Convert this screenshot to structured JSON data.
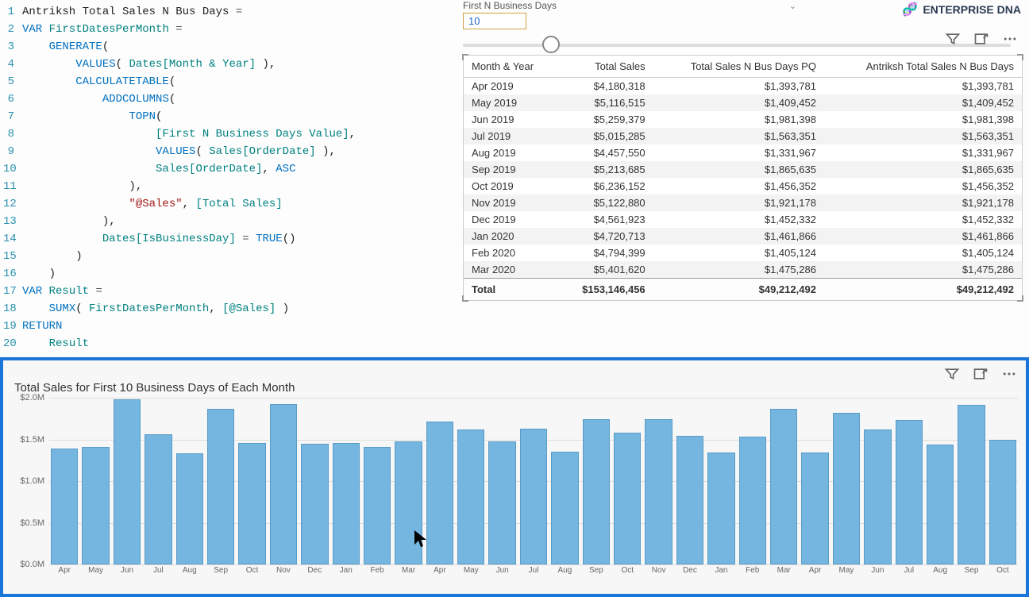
{
  "brand": {
    "text": "ENTERPRISE DNA"
  },
  "code": [
    {
      "n": "1",
      "html": "Antriksh Total Sales N Bus Days <span class='op'>=</span>"
    },
    {
      "n": "2",
      "html": "<span class='kw'>VAR</span> <span class='var'>FirstDatesPerMonth</span> <span class='op'>=</span>"
    },
    {
      "n": "3",
      "html": "    <span class='fn'>GENERATE</span>("
    },
    {
      "n": "4",
      "html": "        <span class='fn'>VALUES</span>( <span class='col'>Dates[Month &amp; Year]</span> ),"
    },
    {
      "n": "5",
      "html": "        <span class='fn'>CALCULATETABLE</span>("
    },
    {
      "n": "6",
      "html": "            <span class='fn'>ADDCOLUMNS</span>("
    },
    {
      "n": "7",
      "html": "                <span class='fn'>TOPN</span>("
    },
    {
      "n": "8",
      "html": "                    <span class='col'>[First N Business Days Value]</span>,"
    },
    {
      "n": "9",
      "html": "                    <span class='fn'>VALUES</span>( <span class='col'>Sales[OrderDate]</span> ),"
    },
    {
      "n": "10",
      "html": "                    <span class='col'>Sales[OrderDate]</span>, <span class='kw'>ASC</span>"
    },
    {
      "n": "11",
      "html": "                ),"
    },
    {
      "n": "12",
      "html": "                <span class='str'>\"@Sales\"</span>, <span class='col'>[Total Sales]</span>"
    },
    {
      "n": "13",
      "html": "            ),"
    },
    {
      "n": "14",
      "html": "            <span class='col'>Dates[IsBusinessDay]</span> <span class='op'>=</span> <span class='fn'>TRUE</span>()"
    },
    {
      "n": "15",
      "html": "        )"
    },
    {
      "n": "16",
      "html": "    )"
    },
    {
      "n": "17",
      "html": "<span class='kw'>VAR</span> <span class='var'>Result</span> <span class='op'>=</span>"
    },
    {
      "n": "18",
      "html": "    <span class='fn'>SUMX</span>( <span class='var'>FirstDatesPerMonth</span>, <span class='col'>[@Sales]</span> )"
    },
    {
      "n": "19",
      "html": "<span class='kw'>RETURN</span>"
    },
    {
      "n": "20",
      "html": "    <span class='var'>Result</span>"
    }
  ],
  "slicer": {
    "label": "First N Business Days",
    "value": "10"
  },
  "table": {
    "headers": [
      "Month & Year",
      "Total Sales",
      "Total Sales N Bus Days PQ",
      "Antriksh Total Sales N Bus Days"
    ],
    "rows": [
      [
        "Apr 2019",
        "$4,180,318",
        "$1,393,781",
        "$1,393,781"
      ],
      [
        "May 2019",
        "$5,116,515",
        "$1,409,452",
        "$1,409,452"
      ],
      [
        "Jun 2019",
        "$5,259,379",
        "$1,981,398",
        "$1,981,398"
      ],
      [
        "Jul 2019",
        "$5,015,285",
        "$1,563,351",
        "$1,563,351"
      ],
      [
        "Aug 2019",
        "$4,457,550",
        "$1,331,967",
        "$1,331,967"
      ],
      [
        "Sep 2019",
        "$5,213,685",
        "$1,865,635",
        "$1,865,635"
      ],
      [
        "Oct 2019",
        "$6,236,152",
        "$1,456,352",
        "$1,456,352"
      ],
      [
        "Nov 2019",
        "$5,122,880",
        "$1,921,178",
        "$1,921,178"
      ],
      [
        "Dec 2019",
        "$4,561,923",
        "$1,452,332",
        "$1,452,332"
      ],
      [
        "Jan 2020",
        "$4,720,713",
        "$1,461,866",
        "$1,461,866"
      ],
      [
        "Feb 2020",
        "$4,794,399",
        "$1,405,124",
        "$1,405,124"
      ],
      [
        "Mar 2020",
        "$5,401,620",
        "$1,475,286",
        "$1,475,286"
      ]
    ],
    "total": [
      "Total",
      "$153,146,456",
      "$49,212,492",
      "$49,212,492"
    ]
  },
  "chart_data": {
    "type": "bar",
    "title": "Total Sales for First 10 Business Days of Each Month",
    "ylabel": "",
    "xlabel": "",
    "ylim": [
      0,
      2000000
    ],
    "y_ticks": [
      "$0.0M",
      "$0.5M",
      "$1.0M",
      "$1.5M",
      "$2.0M"
    ],
    "categories": [
      "Apr",
      "May",
      "Jun",
      "Jul",
      "Aug",
      "Sep",
      "Oct",
      "Nov",
      "Dec",
      "Jan",
      "Feb",
      "Mar",
      "Apr",
      "May",
      "Jun",
      "Jul",
      "Aug",
      "Sep",
      "Oct",
      "Nov",
      "Dec",
      "Jan",
      "Feb",
      "Mar",
      "Apr",
      "May",
      "Jun",
      "Jul",
      "Aug",
      "Sep",
      "Oct"
    ],
    "values": [
      1390000,
      1410000,
      1980000,
      1560000,
      1330000,
      1870000,
      1460000,
      1920000,
      1450000,
      1460000,
      1410000,
      1480000,
      1710000,
      1620000,
      1480000,
      1630000,
      1350000,
      1740000,
      1580000,
      1740000,
      1540000,
      1340000,
      1530000,
      1870000,
      1340000,
      1820000,
      1620000,
      1730000,
      1440000,
      1910000,
      1500000
    ]
  }
}
